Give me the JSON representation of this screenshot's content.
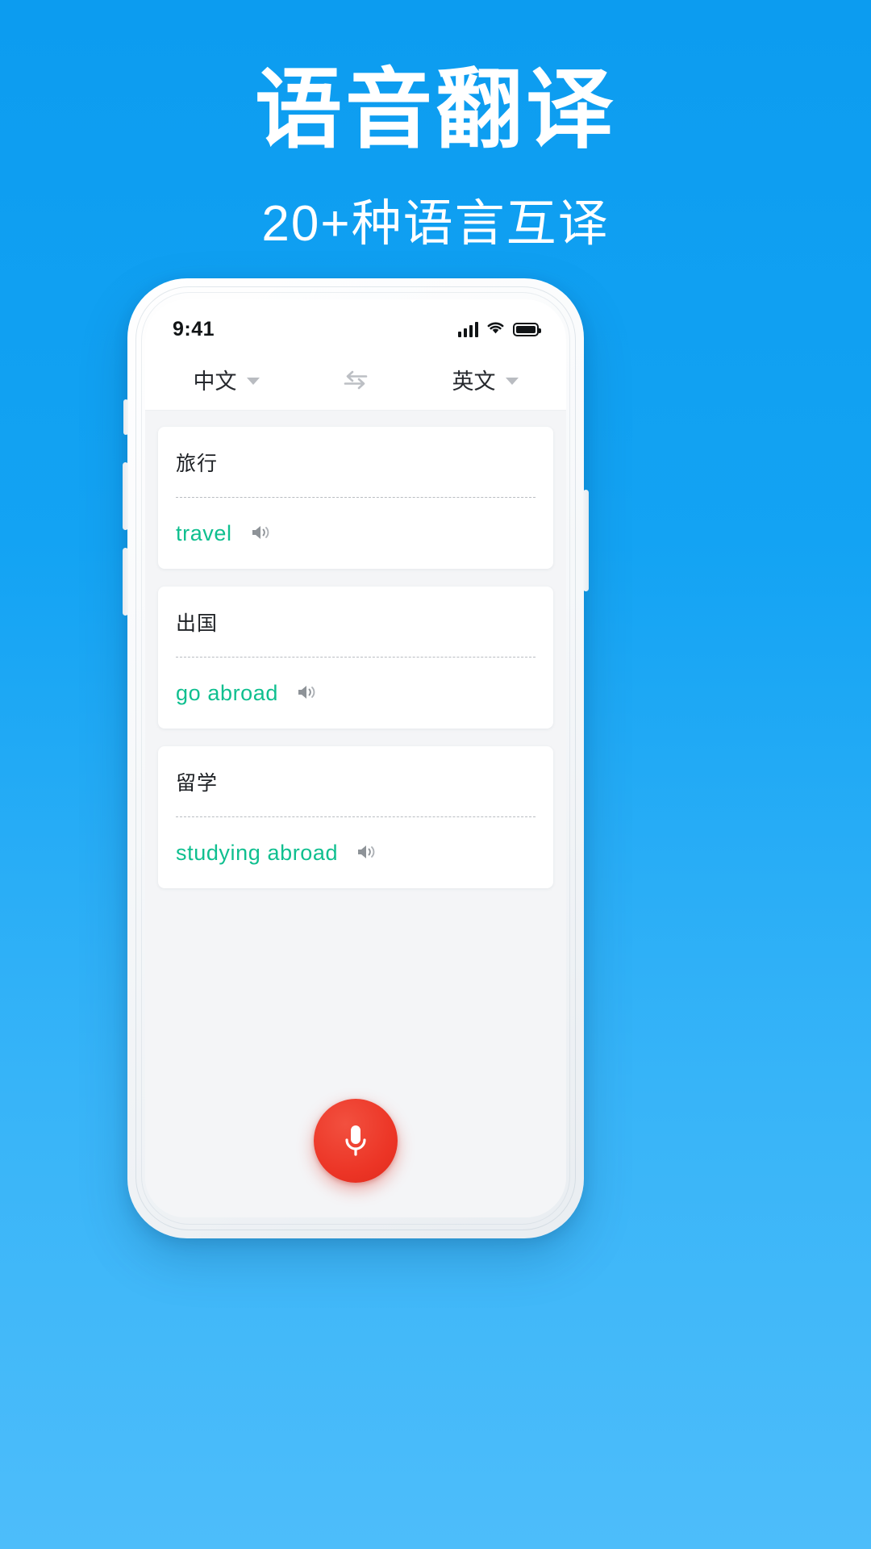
{
  "promo": {
    "headline": "语音翻译",
    "subheadline": "20+种语言互译",
    "background_color": "#13a3f3",
    "headline_color": "#ffffff"
  },
  "phone": {
    "statusbar": {
      "time": "9:41",
      "signal_icon": "signal-bars-icon",
      "wifi_icon": "wifi-icon",
      "battery_icon": "battery-full-icon"
    },
    "language_bar": {
      "source_language": "中文",
      "target_language": "英文",
      "source_caret_icon": "chevron-down-icon",
      "target_caret_icon": "chevron-down-icon",
      "swap_icon": "swap-arrows-icon"
    },
    "cards": [
      {
        "source_text": "旅行",
        "target_text": "travel",
        "speaker_icon": "speaker-icon"
      },
      {
        "source_text": "出国",
        "target_text": "go abroad",
        "speaker_icon": "speaker-icon"
      },
      {
        "source_text": "留学",
        "target_text": "studying abroad",
        "speaker_icon": "speaker-icon"
      }
    ],
    "mic_button": {
      "icon": "microphone-icon",
      "color": "#ec3526"
    },
    "accent_color": "#0fbf8f"
  }
}
